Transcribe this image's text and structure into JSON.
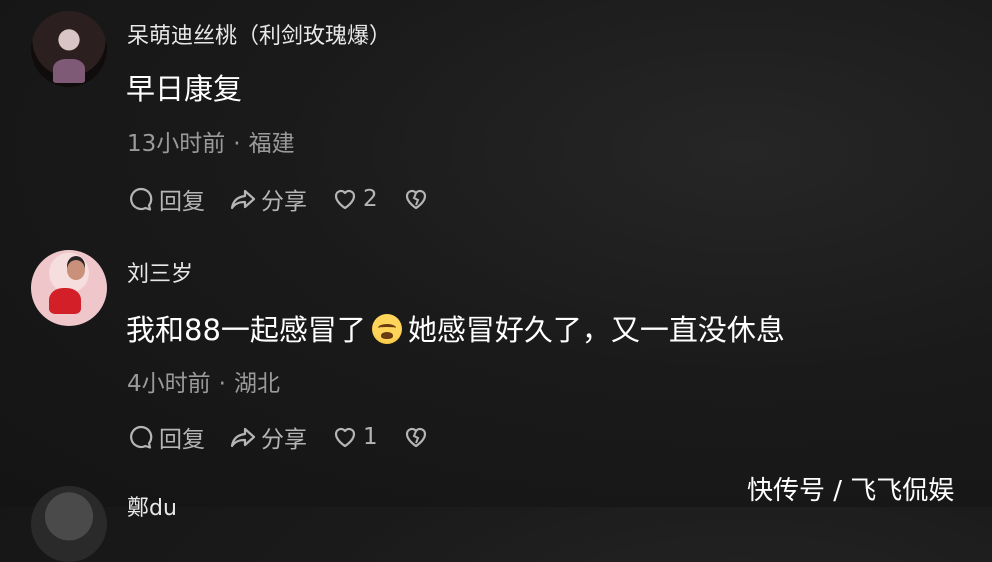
{
  "comments": [
    {
      "username": "呆萌迪丝桃（利剑玫瑰爆）",
      "text": "早日康复",
      "time": "13小时前",
      "location": "福建",
      "reply_label": "回复",
      "share_label": "分享",
      "likes": "2"
    },
    {
      "username": "刘三岁",
      "text_before": "我和88一起感冒了",
      "emoji": "crying-face",
      "text_after": "她感冒好久了，又一直没休息",
      "time": "4小时前",
      "location": "湖北",
      "reply_label": "回复",
      "share_label": "分享",
      "likes": "1"
    },
    {
      "username": "鄭du"
    }
  ],
  "meta_separator": "·",
  "watermark": "快传号 / 飞飞侃娱"
}
